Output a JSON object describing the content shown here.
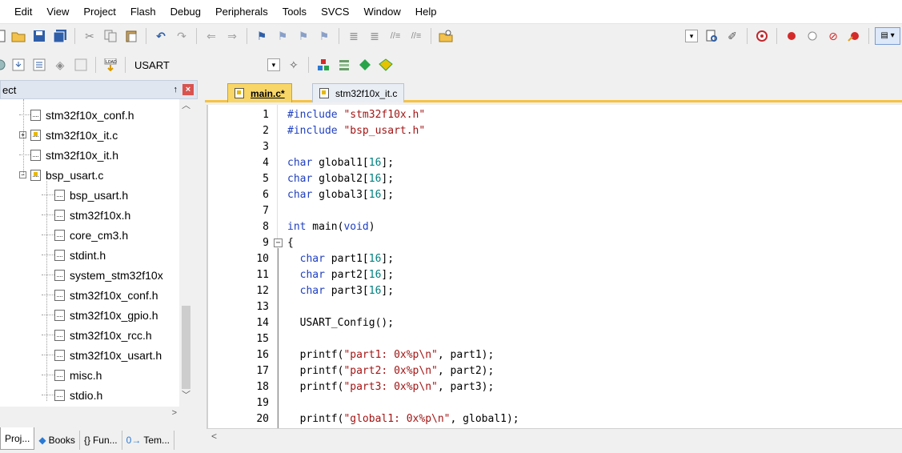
{
  "menu": [
    "Edit",
    "View",
    "Project",
    "Flash",
    "Debug",
    "Peripherals",
    "Tools",
    "SVCS",
    "Window",
    "Help"
  ],
  "toolbar2": {
    "target_label": "USART"
  },
  "project_panel": {
    "title": "ect",
    "pin_glyph": "↑",
    "close_glyph": "×",
    "tree": [
      {
        "label": "stm32f10x_conf.h",
        "indent": 1,
        "expand": "",
        "c": false
      },
      {
        "label": "stm32f10x_it.c",
        "indent": 1,
        "expand": "+",
        "c": true
      },
      {
        "label": "stm32f10x_it.h",
        "indent": 1,
        "expand": "",
        "c": false
      },
      {
        "label": "bsp_usart.c",
        "indent": 1,
        "expand": "−",
        "c": true
      },
      {
        "label": "bsp_usart.h",
        "indent": 2,
        "expand": "",
        "c": false
      },
      {
        "label": "stm32f10x.h",
        "indent": 2,
        "expand": "",
        "c": false
      },
      {
        "label": "core_cm3.h",
        "indent": 2,
        "expand": "",
        "c": false
      },
      {
        "label": "stdint.h",
        "indent": 2,
        "expand": "",
        "c": false
      },
      {
        "label": "system_stm32f10x",
        "indent": 2,
        "expand": "",
        "c": false
      },
      {
        "label": "stm32f10x_conf.h",
        "indent": 2,
        "expand": "",
        "c": false
      },
      {
        "label": "stm32f10x_gpio.h",
        "indent": 2,
        "expand": "",
        "c": false
      },
      {
        "label": "stm32f10x_rcc.h",
        "indent": 2,
        "expand": "",
        "c": false
      },
      {
        "label": "stm32f10x_usart.h",
        "indent": 2,
        "expand": "",
        "c": false
      },
      {
        "label": "misc.h",
        "indent": 2,
        "expand": "",
        "c": false
      },
      {
        "label": "stdio.h",
        "indent": 2,
        "expand": "",
        "c": false
      }
    ],
    "tabs": [
      {
        "label": "Proj...",
        "icon": "",
        "active": true
      },
      {
        "label": "Books",
        "icon": "◆",
        "active": false
      },
      {
        "label": "Fun...",
        "icon": "{}",
        "active": false
      },
      {
        "label": "Tem...",
        "icon": "0→",
        "active": false
      }
    ]
  },
  "editor": {
    "tabs": [
      {
        "label": "main.c*",
        "active": true
      },
      {
        "label": "stm32f10x_it.c",
        "active": false
      }
    ],
    "lines": [
      {
        "n": "1",
        "tokens": [
          [
            "pp",
            "#include "
          ],
          [
            "str",
            "\"stm32f10x.h\""
          ]
        ]
      },
      {
        "n": "2",
        "tokens": [
          [
            "pp",
            "#include "
          ],
          [
            "str",
            "\"bsp_usart.h\""
          ]
        ]
      },
      {
        "n": "3",
        "tokens": []
      },
      {
        "n": "4",
        "tokens": [
          [
            "kw",
            "char"
          ],
          [
            "",
            " global1["
          ],
          [
            "num",
            "16"
          ],
          [
            "",
            "];"
          ]
        ]
      },
      {
        "n": "5",
        "tokens": [
          [
            "kw",
            "char"
          ],
          [
            "",
            " global2["
          ],
          [
            "num",
            "16"
          ],
          [
            "",
            "];"
          ]
        ]
      },
      {
        "n": "6",
        "tokens": [
          [
            "kw",
            "char"
          ],
          [
            "",
            " global3["
          ],
          [
            "num",
            "16"
          ],
          [
            "",
            "];"
          ]
        ]
      },
      {
        "n": "7",
        "tokens": []
      },
      {
        "n": "8",
        "tokens": [
          [
            "kw",
            "int"
          ],
          [
            "",
            " main("
          ],
          [
            "kw",
            "void"
          ],
          [
            "",
            ")"
          ]
        ]
      },
      {
        "n": "9",
        "tokens": [
          [
            "",
            "{"
          ]
        ]
      },
      {
        "n": "10",
        "tokens": [
          [
            "",
            "  "
          ],
          [
            "kw",
            "char"
          ],
          [
            "",
            " part1["
          ],
          [
            "num",
            "16"
          ],
          [
            "",
            "];"
          ]
        ]
      },
      {
        "n": "11",
        "tokens": [
          [
            "",
            "  "
          ],
          [
            "kw",
            "char"
          ],
          [
            "",
            " part2["
          ],
          [
            "num",
            "16"
          ],
          [
            "",
            "];"
          ]
        ]
      },
      {
        "n": "12",
        "tokens": [
          [
            "",
            "  "
          ],
          [
            "kw",
            "char"
          ],
          [
            "",
            " part3["
          ],
          [
            "num",
            "16"
          ],
          [
            "",
            "];"
          ]
        ]
      },
      {
        "n": "13",
        "tokens": []
      },
      {
        "n": "14",
        "tokens": [
          [
            "",
            "  USART_Config();"
          ]
        ]
      },
      {
        "n": "15",
        "tokens": []
      },
      {
        "n": "16",
        "tokens": [
          [
            "",
            "  printf("
          ],
          [
            "str",
            "\"part1: 0x%p\\n\""
          ],
          [
            "",
            ", part1);"
          ]
        ]
      },
      {
        "n": "17",
        "tokens": [
          [
            "",
            "  printf("
          ],
          [
            "str",
            "\"part2: 0x%p\\n\""
          ],
          [
            "",
            ", part2);"
          ]
        ]
      },
      {
        "n": "18",
        "tokens": [
          [
            "",
            "  printf("
          ],
          [
            "str",
            "\"part3: 0x%p\\n\""
          ],
          [
            "",
            ", part3);"
          ]
        ]
      },
      {
        "n": "19",
        "tokens": []
      },
      {
        "n": "20",
        "tokens": [
          [
            "",
            "  printf("
          ],
          [
            "str",
            "\"global1: 0x%p\\n\""
          ],
          [
            "",
            ", global1);"
          ]
        ]
      }
    ]
  },
  "colors": {
    "keyword": "#1f3fbf",
    "string": "#a31515",
    "number": "#008080",
    "active_tab": "#f8d668"
  }
}
